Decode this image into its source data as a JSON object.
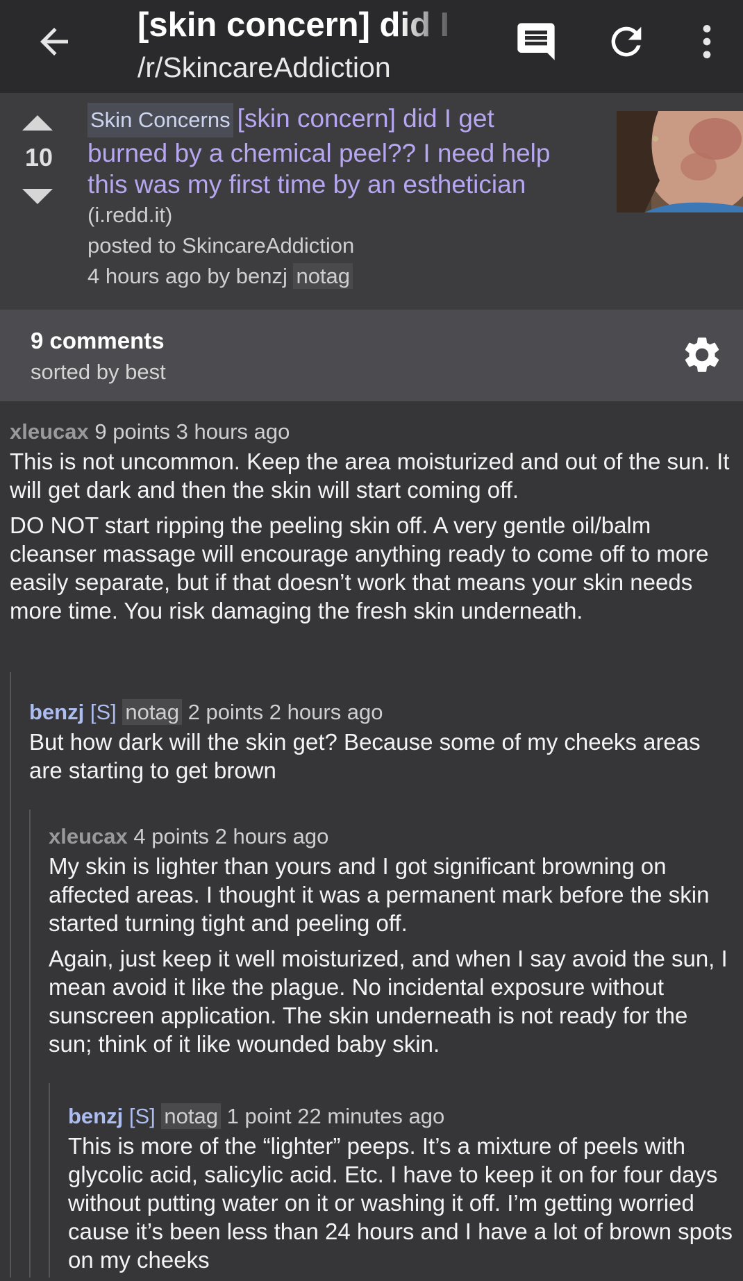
{
  "header": {
    "title": "[skin concern] did I",
    "subreddit": "/r/SkincareAddiction",
    "icons": [
      "back-arrow-icon",
      "comments-icon",
      "refresh-icon",
      "more-vert-icon"
    ]
  },
  "post": {
    "score": "10",
    "flair": "Skin Concerns",
    "title": "[skin concern] did I get burned by a chemical peel?? I need help this was my first time by an esthetician",
    "domain": "(i.redd.it)",
    "posted_to": "posted to SkincareAddiction",
    "time": "4 hours ago by",
    "author": "benzj",
    "user_tag": "notag"
  },
  "comments_bar": {
    "count": "9 comments",
    "sort": "sorted by best"
  },
  "comments": [
    {
      "author": "xleucax",
      "points": "9 points",
      "time": "3 hours ago",
      "paragraphs": [
        "This is not uncommon. Keep the area moisturized and out of the sun. It will get dark and then the skin will start coming off.",
        "DO NOT start ripping the peeling skin off. A very gentle oil/balm cleanser massage will encourage anything ready to come off to more easily separate, but if that doesn’t work that means your skin needs more time. You risk damaging the fresh skin underneath."
      ]
    },
    {
      "author": "benzj",
      "submitter": "[S]",
      "user_tag": "notag",
      "points": "2 points",
      "time": "2 hours ago",
      "paragraphs": [
        "But how dark will the skin get? Because some of my cheeks areas are starting to get brown"
      ]
    },
    {
      "author": "xleucax",
      "points": "4 points",
      "time": "2 hours ago",
      "paragraphs": [
        "My skin is lighter than yours and I got significant browning on affected areas. I thought it was a permanent mark before the skin started turning tight and peeling off.",
        "Again, just keep it well moisturized, and when I say avoid the sun, I mean avoid it like the plague. No incidental exposure without sunscreen application. The skin underneath is not ready for the sun; think of it like wounded baby skin."
      ]
    },
    {
      "author": "benzj",
      "submitter": "[S]",
      "user_tag": "notag",
      "points": "1 point",
      "time": "22 minutes ago",
      "paragraphs": [
        "This is more of the “lighter” peeps. It’s a mixture of peels with glycolic acid, salicylic acid. Etc. I have to keep it on for four days without putting water on it or washing it off. I’m getting worried cause it’s been less than 24 hours and I have a lot of brown spots on my cheeks"
      ]
    }
  ]
}
